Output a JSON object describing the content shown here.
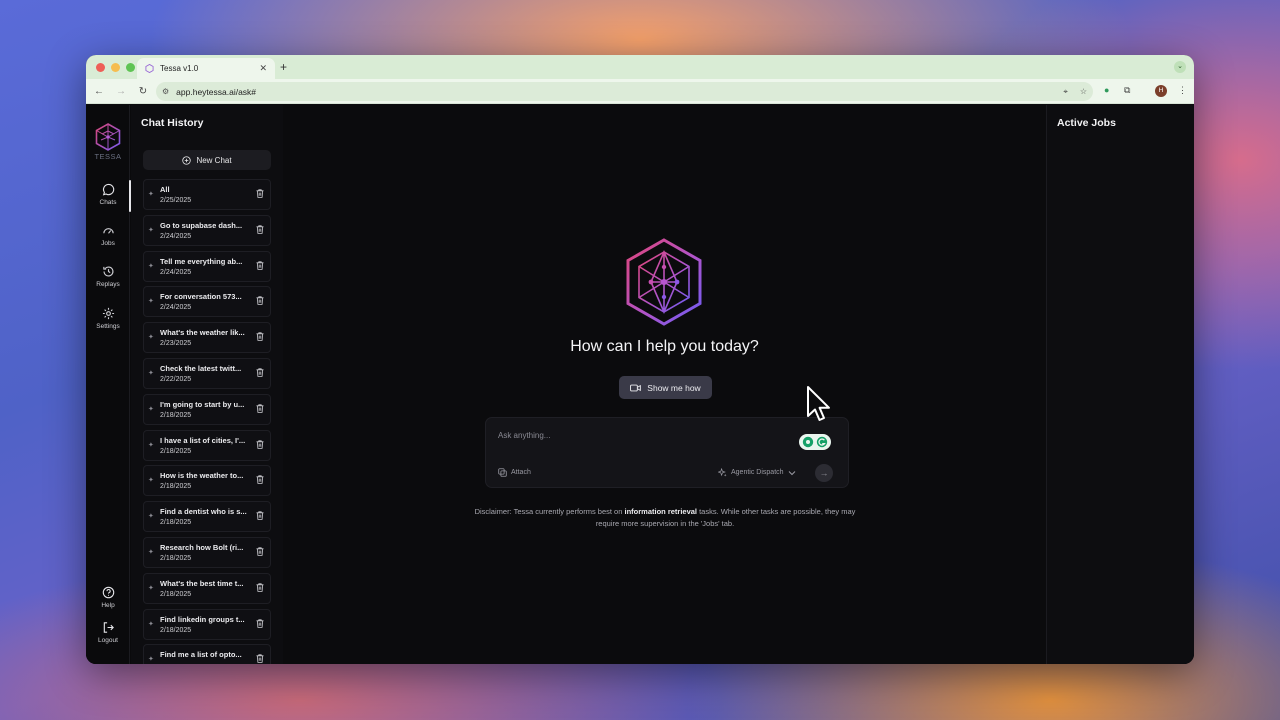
{
  "browser": {
    "tab_title": "Tessa v1.0",
    "new_tab": "+",
    "url": "app.heytessa.ai/ask#",
    "profile_initial": "H"
  },
  "rail": {
    "logo_text": "TESSA",
    "items": [
      {
        "label": "Chats",
        "icon": "chat-bubble-icon"
      },
      {
        "label": "Jobs",
        "icon": "gauge-icon"
      },
      {
        "label": "Replays",
        "icon": "history-icon"
      },
      {
        "label": "Settings",
        "icon": "gear-icon"
      }
    ],
    "bottom": [
      {
        "label": "Help",
        "icon": "help-circle-icon"
      },
      {
        "label": "Logout",
        "icon": "logout-icon"
      }
    ]
  },
  "history": {
    "title": "Chat History",
    "new_chat": "New Chat",
    "items": [
      {
        "title": "All",
        "date": "2/25/2025"
      },
      {
        "title": "Go to supabase dash...",
        "date": "2/24/2025"
      },
      {
        "title": "Tell me everything ab...",
        "date": "2/24/2025"
      },
      {
        "title": "For conversation 573...",
        "date": "2/24/2025"
      },
      {
        "title": "What's the weather lik...",
        "date": "2/23/2025"
      },
      {
        "title": "Check the latest twitt...",
        "date": "2/22/2025"
      },
      {
        "title": "I'm going to start by u...",
        "date": "2/18/2025"
      },
      {
        "title": "I have a list of cities, I'...",
        "date": "2/18/2025"
      },
      {
        "title": "How is the weather to...",
        "date": "2/18/2025"
      },
      {
        "title": "Find a dentist who is s...",
        "date": "2/18/2025"
      },
      {
        "title": "Research how Bolt (ri...",
        "date": "2/18/2025"
      },
      {
        "title": "What's the best time t...",
        "date": "2/18/2025"
      },
      {
        "title": "Find linkedin groups t...",
        "date": "2/18/2025"
      },
      {
        "title": "Find me a list of opto...",
        "date": ""
      }
    ]
  },
  "main": {
    "headline": "How can I help you today?",
    "show_me_how": "Show me how",
    "placeholder": "Ask anything...",
    "attach": "Attach",
    "dispatch": "Agentic Dispatch",
    "disclaimer_pre": "Disclaimer: Tessa currently performs best on ",
    "disclaimer_bold": "information retrieval",
    "disclaimer_post": " tasks. While other tasks are possible, they may require more supervision in the 'Jobs' tab."
  },
  "jobs": {
    "title": "Active Jobs"
  },
  "colors": {
    "accent_purple": "#8b5cf6",
    "accent_pink": "#d9467a",
    "app_bg": "#0a0a0c"
  }
}
